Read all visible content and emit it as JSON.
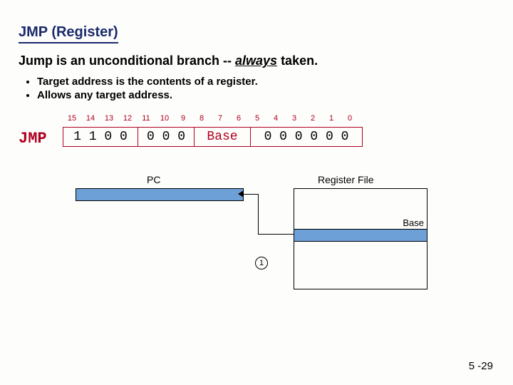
{
  "title": "JMP (Register)",
  "subtitle_pre": "Jump is an unconditional branch -- ",
  "subtitle_emph": "always",
  "subtitle_post": " taken.",
  "bullets": [
    "Target address is the contents of a register.",
    "Allows any target address."
  ],
  "encoding": {
    "mnemonic": "JMP",
    "bit_indices": [
      "15",
      "14",
      "13",
      "12",
      "11",
      "10",
      "9",
      "8",
      "7",
      "6",
      "5",
      "4",
      "3",
      "2",
      "1",
      "0"
    ],
    "group_opcode": "1 1 0 0",
    "group_zeroA": "0 0 0",
    "group_base": "Base",
    "group_zeroB": "0 0 0 0 0 0"
  },
  "datapath": {
    "pc_label": "PC",
    "rf_label": "Register File",
    "rf_row_label": "Base",
    "step_label": "1"
  },
  "page_number": "5 -29"
}
